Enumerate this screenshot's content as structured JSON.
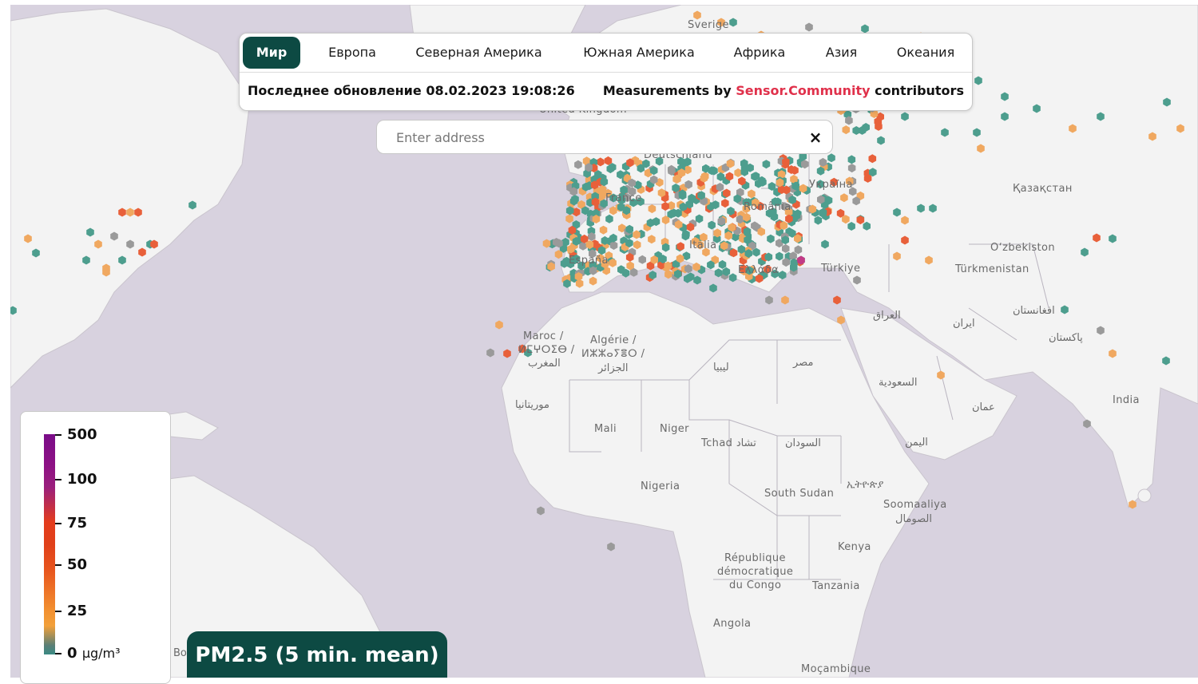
{
  "tabs": [
    {
      "label": "Мир",
      "active": true
    },
    {
      "label": "Европа",
      "active": false
    },
    {
      "label": "Северная Америка",
      "active": false
    },
    {
      "label": "Южная Америка",
      "active": false
    },
    {
      "label": "Африка",
      "active": false
    },
    {
      "label": "Азия",
      "active": false
    },
    {
      "label": "Океания",
      "active": false
    }
  ],
  "status": {
    "updated_text": "Последнее обновление 08.02.2023 19:08:26",
    "measurements_prefix": "Measurements by",
    "source_name": "Sensor.Community",
    "measurements_suffix": "contributors"
  },
  "search": {
    "placeholder": "Enter address",
    "value": "",
    "clear_symbol": "×"
  },
  "legend": {
    "unit": "μg/m³",
    "scale": [
      {
        "value": "500"
      },
      {
        "value": "100"
      },
      {
        "value": "75"
      },
      {
        "value": "50"
      },
      {
        "value": "25"
      },
      {
        "value": "0"
      }
    ]
  },
  "metric_button": "PM2.5 (5 min. mean)",
  "map_labels": {
    "sverige": "Sverige",
    "uk": "United Kingdom",
    "deutschland": "Deutschland",
    "ukraina": "Україна",
    "kazakhstan": "Қазақстан",
    "france": "France",
    "romania": "România",
    "italia": "Italia",
    "espana": "España",
    "uzbekistan": "O‘zbekiston",
    "turkiye": "Türkiye",
    "ellada": "Ελλάδα",
    "turkmenistan": "Türkmenistan",
    "iraq": "العراق",
    "iran": "ایران",
    "afghanistan": "افغانستان",
    "maroc1": "Maroc /",
    "maroc2": "ⵍⵎⵖⵔⵉⴱ /",
    "maroc3": "المغرب",
    "algerie1": "Algérie /",
    "algerie2": "ⵍⵣⵣⴰⵢⴻⵔ /",
    "algerie3": "الجزائر",
    "libya": "ليبيا",
    "misr": "مصر",
    "pakistan": "پاکستان",
    "saudi": "السعودية",
    "oman": "عمان",
    "mauritania": "موريتانيا",
    "india": "India",
    "mali": "Mali",
    "niger": "Niger",
    "tchad": "Tchad تشاد",
    "sudan": "السودان",
    "yemen": "اليمن",
    "nigeria": "Nigeria",
    "ethiopia": "ኢትዮጵያ",
    "south_sudan": "South Sudan",
    "somalia1": "Soomaaliya",
    "somalia2": "الصومال",
    "kenya": "Kenya",
    "rdc1": "République",
    "rdc2": "démocratique",
    "rdc3": "du Congo",
    "tanzania": "Tanzania",
    "angola": "Angola",
    "mozambique": "Moçambique",
    "partial_bo": "Bo"
  },
  "colors": {
    "accent": "#0d4a43",
    "link": "#e0314b",
    "sensor_low": "#4d9e8e",
    "sensor_moderate": "#f0a860",
    "sensor_high": "#e8603a",
    "sensor_very_high": "#c23a86",
    "sensor_offline": "#9a9a9a"
  }
}
